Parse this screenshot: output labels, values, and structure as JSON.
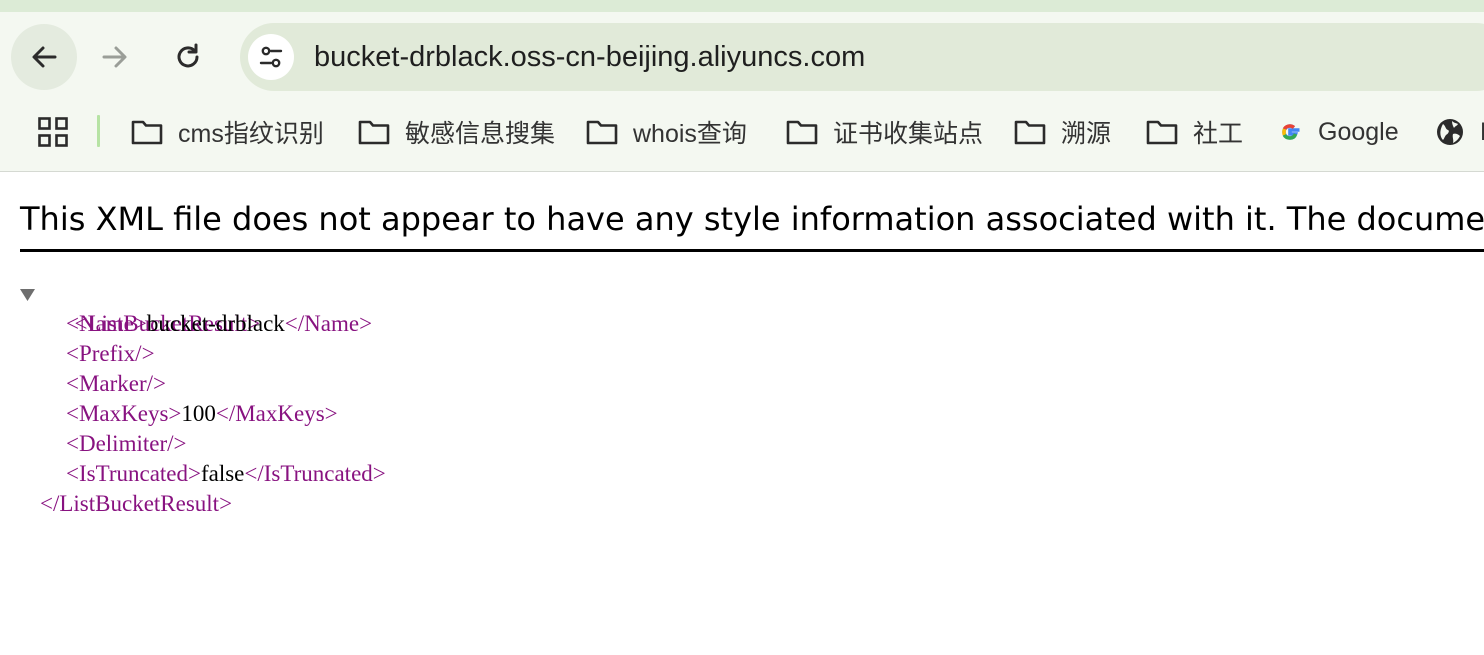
{
  "browser": {
    "url": "bucket-drblack.oss-cn-beijing.aliyuncs.com",
    "nav_icons": [
      "back-arrow-icon",
      "forward-arrow-icon",
      "reload-icon",
      "site-info-icon"
    ]
  },
  "bookmarks": {
    "apps_icon": "apps-grid-icon",
    "items": [
      {
        "label": "cms指纹识别",
        "icon": "folder-icon"
      },
      {
        "label": "敏感信息搜集",
        "icon": "folder-icon"
      },
      {
        "label": "whois查询",
        "icon": "folder-icon"
      },
      {
        "label": "证书收集站点",
        "icon": "folder-icon"
      },
      {
        "label": "溯源",
        "icon": "folder-icon"
      },
      {
        "label": "社工",
        "icon": "folder-icon"
      },
      {
        "label": "Google",
        "icon": "google-icon"
      },
      {
        "label": "F",
        "icon": "globe-icon"
      }
    ]
  },
  "page": {
    "banner": "This XML file does not appear to have any style information associated with it. The document tree is shown below.",
    "xml": {
      "root_open": "<ListBucketResult>",
      "name_open": "<Name>",
      "name_value": "bucket-drblack",
      "name_close": "</Name>",
      "prefix": "<Prefix/>",
      "marker": "<Marker/>",
      "maxkeys_open": "<MaxKeys>",
      "maxkeys_value": "100",
      "maxkeys_close": "</MaxKeys>",
      "delimiter": "<Delimiter/>",
      "truncated_open": "<IsTruncated>",
      "truncated_value": "false",
      "truncated_close": "</IsTruncated>",
      "root_close": "</ListBucketResult>"
    }
  },
  "colors": {
    "tag": "#881280",
    "toolbar_bg": "#f4f8f1",
    "omnibox_bg": "#e1ead9",
    "top_strip": "#dcebd6",
    "separator": "#b6e3a4"
  }
}
